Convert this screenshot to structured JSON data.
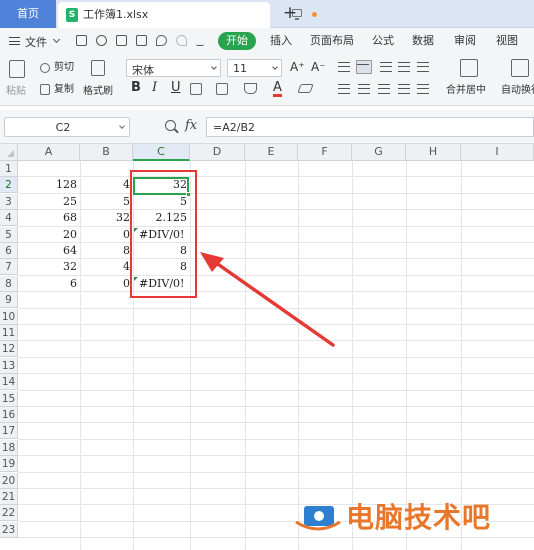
{
  "tabs": {
    "home_label": "首页",
    "file_logo": "S",
    "file_name": "工作簿1.xlsx",
    "new_tab": "+"
  },
  "menu": {
    "file_label": "文件",
    "start_label": "开始",
    "items": [
      "插入",
      "页面布局",
      "公式",
      "数据",
      "审阅",
      "视图"
    ]
  },
  "ribbon": {
    "paste_label": "粘贴",
    "cut_label": "剪切",
    "copy_label": "复制",
    "format_painter_label": "格式刷",
    "font_name": "宋体",
    "font_size": "11",
    "bold": "B",
    "italic": "I",
    "underline": "U",
    "font_color_glyph": "A",
    "grow_font": "A⁺",
    "shrink_font": "A⁻",
    "merge_label": "合并居中",
    "wrap_label": "自动换行"
  },
  "formula_bar": {
    "cell_ref": "C2",
    "fx_label": "fx",
    "formula": "=A2/B2"
  },
  "grid": {
    "columns": [
      "A",
      "B",
      "C",
      "D",
      "E",
      "F",
      "G",
      "H",
      "I"
    ],
    "active_column": "C",
    "rows": [
      "1",
      "2",
      "3",
      "4",
      "5",
      "6",
      "7",
      "8",
      "9",
      "10",
      "11",
      "12",
      "13",
      "14",
      "15",
      "16",
      "17",
      "18",
      "19",
      "20",
      "21",
      "22",
      "23"
    ],
    "active_row": "2",
    "data": [
      {
        "row": 2,
        "a": "128",
        "b": "4",
        "c": "32"
      },
      {
        "row": 3,
        "a": "25",
        "b": "5",
        "c": "5"
      },
      {
        "row": 4,
        "a": "68",
        "b": "32",
        "c": "2.125"
      },
      {
        "row": 5,
        "a": "20",
        "b": "0",
        "c": "#DIV/0!"
      },
      {
        "row": 6,
        "a": "64",
        "b": "8",
        "c": "8"
      },
      {
        "row": 7,
        "a": "32",
        "b": "4",
        "c": "8"
      },
      {
        "row": 8,
        "a": "6",
        "b": "0",
        "c": "#DIV/0!"
      }
    ]
  },
  "colors": {
    "accent_green": "#2aa34f",
    "highlight_red": "#e53935",
    "home_tab_blue": "#4f82d8"
  },
  "watermark": {
    "text": "电脑技术吧"
  }
}
